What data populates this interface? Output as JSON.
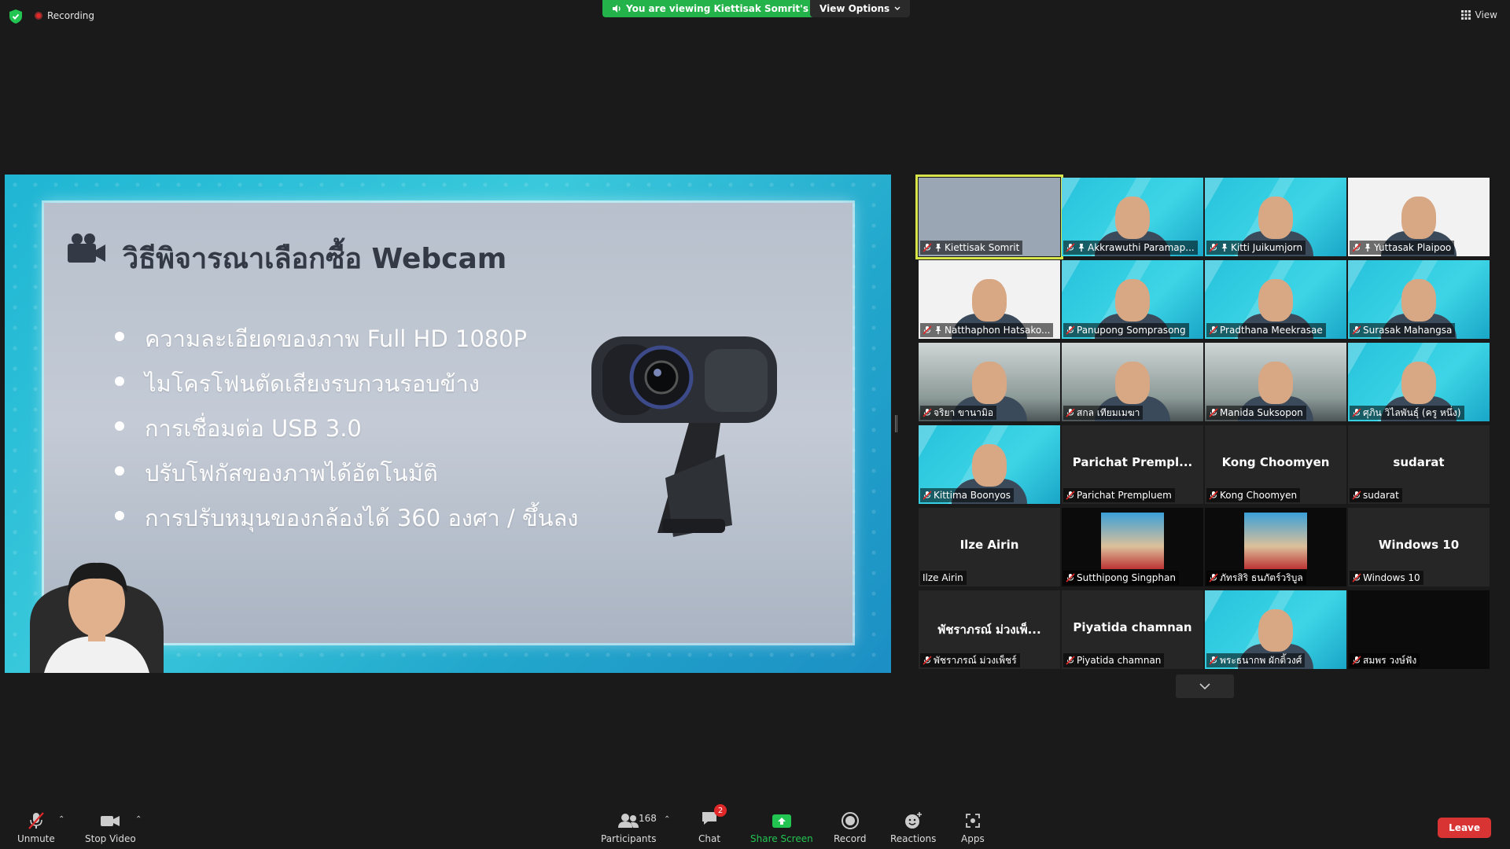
{
  "topbar": {
    "recording_label": "Recording",
    "viewing_banner": "You are viewing Kiettisak Somrit's screen",
    "view_options_label": "View Options",
    "view_label": "View"
  },
  "share": {
    "slide_title": "วิธีพิจารณาเลือกซื้อ Webcam",
    "bullets": [
      "ความละเอียดของภาพ Full HD 1080P",
      "ไมโครโฟนตัดเสียงรบกวนรอบข้าง",
      "การเชื่อมต่อ USB 3.0",
      "ปรับโฟกัสของภาพได้อัตโนมัติ",
      "การปรับหมุนของกล้องได้ 360 องศา / ขึ้นลง"
    ]
  },
  "gallery": {
    "tiles": [
      {
        "name": "Kiettisak Somrit",
        "center": ""
      },
      {
        "name": "Akkrawuthi Paramap...",
        "center": ""
      },
      {
        "name": "Kitti Juikumjorn",
        "center": ""
      },
      {
        "name": "Yuttasak Plaipoo",
        "center": ""
      },
      {
        "name": "Natthaphon Hatsako...",
        "center": ""
      },
      {
        "name": "Panupong Somprasong",
        "center": ""
      },
      {
        "name": "Pradthana Meekrasae",
        "center": ""
      },
      {
        "name": "Surasak Mahangsa",
        "center": ""
      },
      {
        "name": "จริยา ขานามิอ",
        "center": ""
      },
      {
        "name": "สกล เทียมเมฆา",
        "center": ""
      },
      {
        "name": "Manida Suksopon",
        "center": ""
      },
      {
        "name": "ศุภิน วิไลพันธุ์ (ครู หนึ่ง)",
        "center": ""
      },
      {
        "name": "Kittima Boonyos",
        "center": ""
      },
      {
        "name": "Parichat Prempluem",
        "center": "Parichat Prempl..."
      },
      {
        "name": "Kong Choomyen",
        "center": "Kong Choomyen"
      },
      {
        "name": "sudarat",
        "center": "sudarat"
      },
      {
        "name": "Ilze Airin",
        "center": "Ilze Airin"
      },
      {
        "name": "Sutthipong Singphan",
        "center": ""
      },
      {
        "name": "ภัทรสิริ ธนภัตร์วริบูล",
        "center": ""
      },
      {
        "name": "Windows 10",
        "center": "Windows 10"
      },
      {
        "name": "พัชราภรณ์ ม่วงเพ็ชร์",
        "center": "พัชราภรณ์ ม่วงเพ็..."
      },
      {
        "name": "Piyatida chamnan",
        "center": "Piyatida chamnan"
      },
      {
        "name": "พระธนากพ ผักติ้วงศ์",
        "center": ""
      },
      {
        "name": "สมพร วงษ์ฟัง",
        "center": ""
      }
    ]
  },
  "toolbar": {
    "unmute": "Unmute",
    "stop_video": "Stop Video",
    "participants": "Participants",
    "participants_count": "168",
    "chat": "Chat",
    "chat_badge": "2",
    "share_screen": "Share Screen",
    "record": "Record",
    "reactions": "Reactions",
    "apps": "Apps",
    "leave": "Leave"
  },
  "colors": {
    "viewing_banner": "#23b34a",
    "leave": "#d83434",
    "active_speaker": "#d7e54a",
    "share_green": "#23c552"
  }
}
